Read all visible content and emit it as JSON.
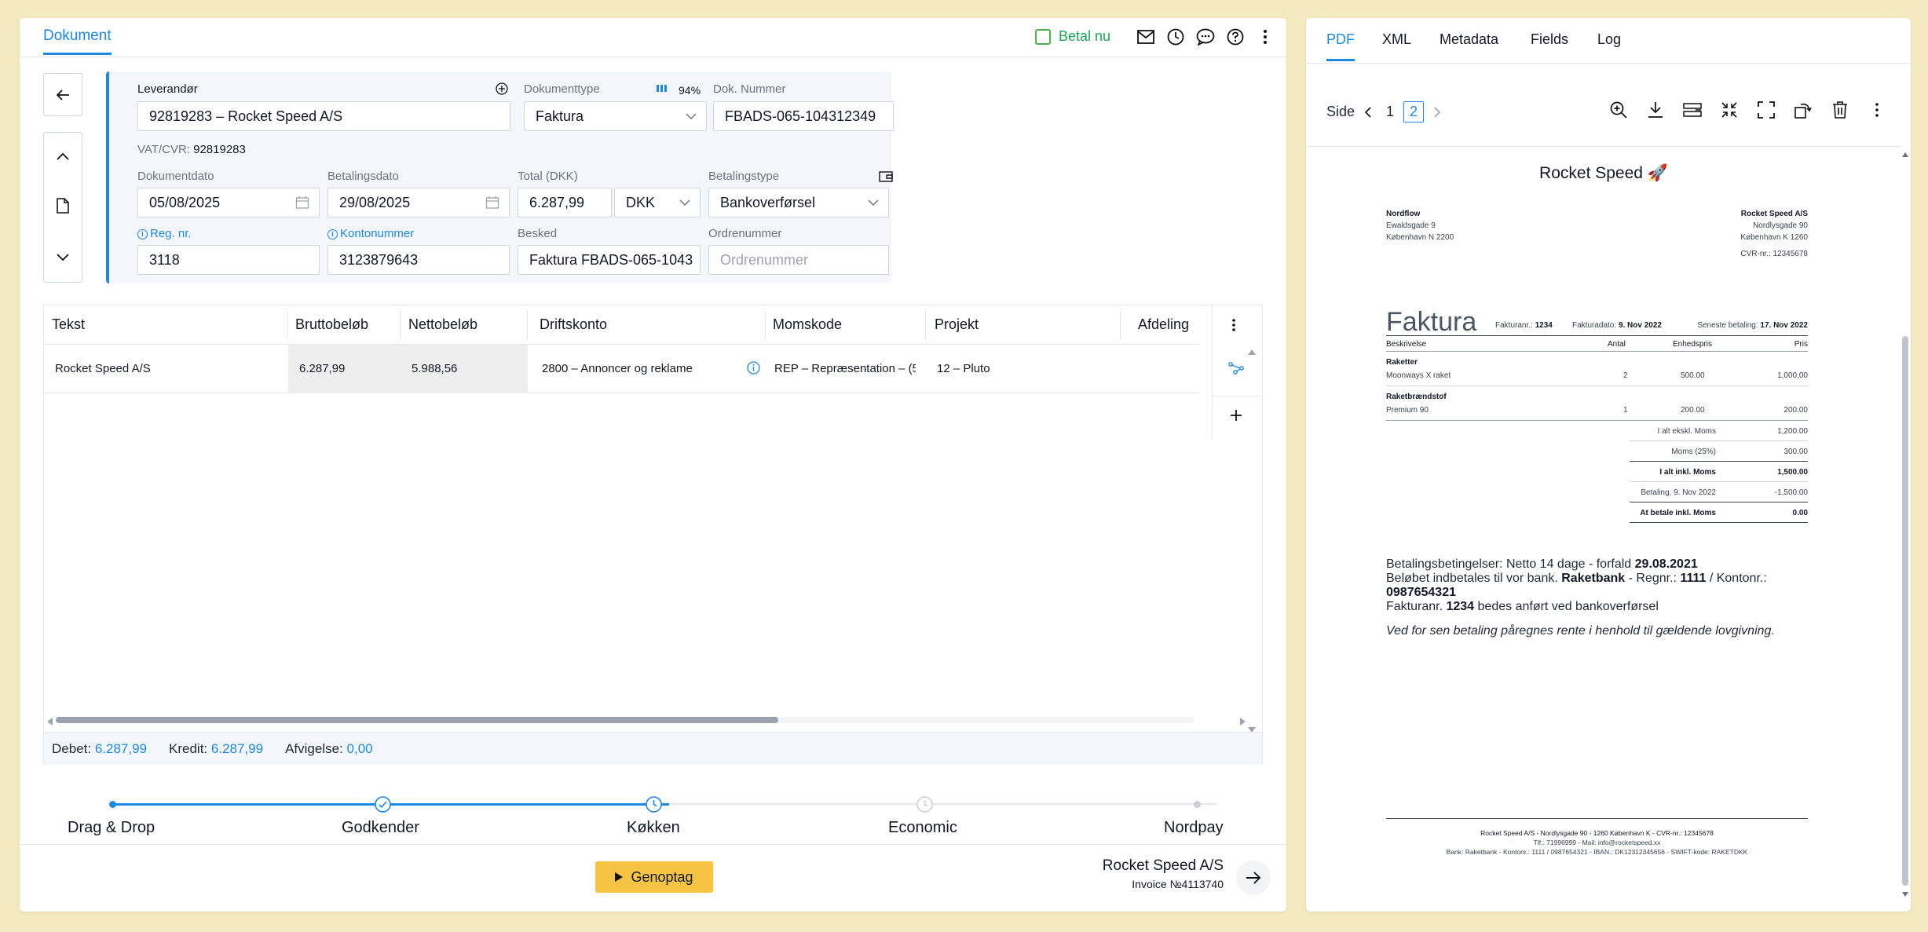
{
  "header": {
    "tab": "Dokument",
    "betal_label": "Betal nu",
    "icons": [
      "mail-icon",
      "clock-icon",
      "chat-icon",
      "help-icon",
      "more-vertical-icon"
    ]
  },
  "form": {
    "leverandor_label": "Leverandør",
    "leverandor_value": "92819283 – Rocket Speed A/S",
    "vat_label": "VAT/CVR:",
    "vat_value": "92819283",
    "dokumenttype_label": "Dokumenttype",
    "confidence": "94%",
    "dokumenttype_value": "Faktura",
    "doknummer_label": "Dok. Nummer",
    "doknummer_value": "FBADS-065-104312349",
    "dokumentdato_label": "Dokumentdato",
    "dokumentdato_value": "05/08/2025",
    "betalingsdato_label": "Betalingsdato",
    "betalingsdato_value": "29/08/2025",
    "total_label": "Total (DKK)",
    "total_value": "6.287,99",
    "currency_value": "DKK",
    "betalingstype_label": "Betalingstype",
    "betalingstype_value": "Bankoverførsel",
    "regnr_label": "Reg. nr.",
    "regnr_value": "3118",
    "kontonummer_label": "Kontonummer",
    "kontonummer_value": "3123879643",
    "besked_label": "Besked",
    "besked_value": "Faktura FBADS-065-1043",
    "ordrenummer_label": "Ordrenummer",
    "ordrenummer_placeholder": "Ordrenummer"
  },
  "table": {
    "columns": [
      "Tekst",
      "Bruttobeløb",
      "Nettobeløb",
      "Driftskonto",
      "Momskode",
      "Projekt",
      "Afdeling"
    ],
    "rows": [
      {
        "tekst": "Rocket Speed A/S",
        "brutto": "6.287,99",
        "netto": "5.988,56",
        "driftskonto": "2800 – Annoncer og reklame",
        "momskode": "REP – Repræsentation – (5",
        "projekt": "12 – Pluto",
        "afdeling": ""
      }
    ]
  },
  "totals": {
    "debet_label": "Debet:",
    "debet_value": "6.287,99",
    "kredit_label": "Kredit:",
    "kredit_value": "6.287,99",
    "afvigelse_label": "Afvigelse:",
    "afvigelse_value": "0,00"
  },
  "workflow": {
    "steps": [
      {
        "label": "Drag & Drop",
        "state": "done"
      },
      {
        "label": "Godkender",
        "state": "done"
      },
      {
        "label": "Køkken",
        "state": "current"
      },
      {
        "label": "Economic",
        "state": "pending"
      },
      {
        "label": "Nordpay",
        "state": "pending"
      }
    ]
  },
  "footer": {
    "button_label": "Genoptag",
    "vendor": "Rocket Speed A/S",
    "invoice": "Invoice №4113740"
  },
  "viewer": {
    "tabs": [
      "PDF",
      "XML",
      "Metadata",
      "Fields",
      "Log"
    ],
    "side_label": "Side",
    "pages": [
      "1",
      "2"
    ],
    "current_page": "2",
    "tools": [
      "zoom-in-icon",
      "download-icon",
      "split-icon",
      "compress-icon",
      "fullscreen-icon",
      "rotate-icon",
      "trash-icon",
      "more-vertical-icon"
    ]
  },
  "invoice": {
    "brand": "Rocket Speed 🚀",
    "from_name": "Nordflow",
    "from_addr1": "Ewaldsgade 9",
    "from_addr2": "København N 2200",
    "to_name": "Rocket Speed A/S",
    "to_addr1": "Nordlysgade 90",
    "to_addr2": "København K 1260",
    "to_cvr": "CVR-nr.: 12345678",
    "title": "Faktura",
    "fakturanr_label": "Fakturanr.:",
    "fakturanr": "1234",
    "fakturadato_label": "Fakturadato:",
    "fakturadato": "9. Nov 2022",
    "seneste_label": "Seneste betaling:",
    "seneste": "17. Nov 2022",
    "col_beskrivelse": "Beskrivelse",
    "col_antal": "Antal",
    "col_enhedspris": "Enhedspris",
    "col_pris": "Pris",
    "group1": "Raketter",
    "item1": "Moonways X raket",
    "item1_qty": "2",
    "item1_unit": "500.00",
    "item1_price": "1,000.00",
    "group2": "Raketbrændstof",
    "item2": "Premium 90",
    "item2_qty": "1",
    "item2_unit": "200.00",
    "item2_price": "200.00",
    "sum1_label": "I alt ekskl. Moms",
    "sum1": "1,200.00",
    "moms_label": "Moms (25%)",
    "moms": "300.00",
    "sum2_label": "I alt inkl. Moms",
    "sum2": "1,500.00",
    "paid_label": "Betaling, 9. Nov 2022",
    "paid": "-1,500.00",
    "due_label": "At betale inkl. Moms",
    "due": "0.00",
    "terms_prefix": "Betalingsbetingelser: Netto 14 dage - forfald",
    "terms_date": "29.08.2021",
    "bank_prefix": "Beløbet indbetales til vor bank.",
    "bank_name": "Raketbank",
    "bank_reg_label": "- Regnr.:",
    "bank_reg": "1111",
    "bank_konto_label": "/ Kontonr.:",
    "bank_konto": "0987654321",
    "fakt_prefix": "Fakturanr.",
    "fakt_nr": "1234",
    "fakt_suffix": "bedes anført ved bankoverførsel",
    "late_note": "Ved for sen betaling påregnes rente i henhold til gældende lovgivning.",
    "footer1": "Rocket Speed A/S - Nordlysgade 90 - 1260 København K - CVR-nr.: 12345678",
    "footer2": "Tlf.: 71996999 - Mail: info@rocketspeed.xx",
    "footer3": "Bank: Raketbank - Kontonr.: 1111 / 0987654321 - IBAN.: DK12312345656 - SWIFT-kode: RAKETDKK"
  }
}
